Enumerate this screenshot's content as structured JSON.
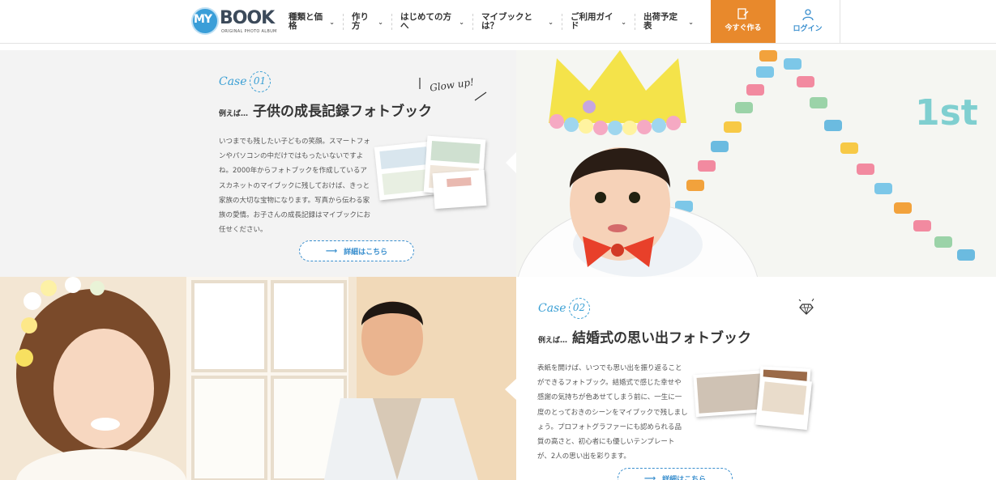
{
  "header": {
    "logo": {
      "my": "MY",
      "book": "BOOK",
      "sub": "ORIGINAL PHOTO ALBUM"
    },
    "nav": [
      {
        "label": "種類と価\n格"
      },
      {
        "label": "作り方"
      },
      {
        "label": "はじめての方\nへ"
      },
      {
        "label": "マイブックと\nは？"
      },
      {
        "label": "ご利用ガイ\nド"
      },
      {
        "label": "出荷予定表"
      }
    ],
    "cta_label": "今すぐ作る",
    "login_label": "ログイン",
    "colors": {
      "cta": "#e8892c",
      "accent": "#3a8fce"
    }
  },
  "case1": {
    "case_word": "Case",
    "case_number": "01",
    "prefix": "例えば…",
    "title": "子供の成長記録フォトブック",
    "deco_text": "Glow up!",
    "body": "いつまでも残したい子どもの笑顔。スマートフォンやパソコンの中だけではもったいないですよね。2000年からフォトブックを作成しているアスカネットのマイブックに残しておけば、きっと家族の大切な宝物になります。写真から伝わる家族の愛情。お子さんの成長記録はマイブックにお任せください。",
    "button": "詳細はこちら",
    "photo_text": "1st"
  },
  "case2": {
    "case_word": "Case",
    "case_number": "02",
    "prefix": "例えば…",
    "title": "結婚式の思い出フォトブック",
    "body": "表紙を開けば、いつでも思い出を振り返ることができるフォトブック。結婚式で感じた幸せや感謝の気持ちが色あせてしまう前に、一生に一度のとっておきのシーンをマイブックで残しましょう。プロフォトグラファーにも認められる品質の高さと、初心者にも優しいテンプレートが、2人の思い出を彩ります。",
    "button": "詳細はこちら"
  }
}
